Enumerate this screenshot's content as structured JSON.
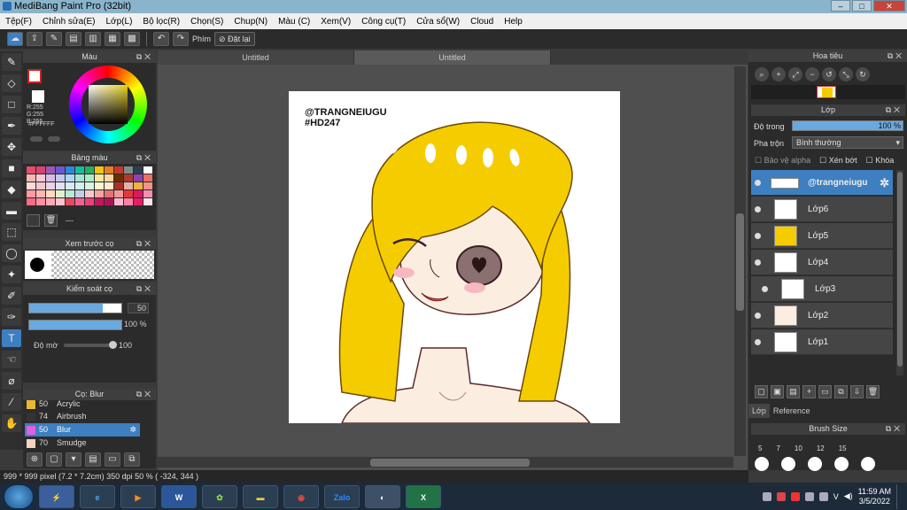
{
  "app": {
    "title": "MediBang Paint Pro (32bit)"
  },
  "window_buttons": [
    "–",
    "□",
    "✕"
  ],
  "menu": [
    "Tệp(F)",
    "Chỉnh sửa(E)",
    "Lớp(L)",
    "Bộ lọc(R)",
    "Chọn(S)",
    "Chup(N)",
    "Màu (C)",
    "Xem(V)",
    "Công cụ(T)",
    "Cửa sổ(W)",
    "Cloud",
    "Help"
  ],
  "toolbar": {
    "shortcut_label": "Phím",
    "reset_label": "Đặt lại"
  },
  "color_panel": {
    "title": "Màu",
    "r": "R:255",
    "g": "G:255",
    "b": "B:255",
    "hex": "#FFFFFF"
  },
  "palette_panel": {
    "title": "Bảng màu",
    "dash": "---"
  },
  "preview_panel": {
    "title": "Xem trước cọ"
  },
  "control_panel": {
    "title": "Kiểm soát cọ",
    "size_value": "50",
    "size_fill": 0.8,
    "opacity_value": "100 %",
    "opacity_fill": 1.0,
    "density_label": "Độ mờ",
    "density_value": "100"
  },
  "brush_panel": {
    "title": "Cọ: Blur",
    "items": [
      {
        "size": "50",
        "name": "Acrylic",
        "color": "#e8b830"
      },
      {
        "size": "74",
        "name": "Airbrush",
        "color": "#333333"
      },
      {
        "size": "50",
        "name": "Blur",
        "color": "#e060e0",
        "selected": true
      },
      {
        "size": "70",
        "name": "Smudge",
        "color": "#f5d5c0"
      }
    ]
  },
  "document_tabs": [
    {
      "label": "Untitled",
      "active": false
    },
    {
      "label": "Untitled",
      "active": true
    }
  ],
  "canvas_text": {
    "line1": "@TRANGNEIUGU",
    "line2": "#HD247"
  },
  "status": "999 * 999 pixel   (7.2 * 7.2cm)   350 dpi   50 %   ( -324, 344 )",
  "navigator": {
    "title": "Hoa tiêu"
  },
  "layer_panel": {
    "title": "Lớp",
    "opacity_label": "Độ trong",
    "opacity_value": "100 %",
    "blend_label": "Pha trộn",
    "blend_value": "Bình thường",
    "protect_alpha": "Bảo vệ alpha",
    "clipping": "Xén bớt",
    "lock": "Khóa",
    "layers": [
      {
        "name": "@trangneiugu",
        "selected": true
      },
      {
        "name": "Lớp6"
      },
      {
        "name": "Lớp5"
      },
      {
        "name": "Lớp4"
      },
      {
        "name": "Lớp3",
        "indent": true
      },
      {
        "name": "Lớp2"
      },
      {
        "name": "Lớp1"
      }
    ],
    "tabs": [
      "Lớp",
      "Reference"
    ]
  },
  "brush_size": {
    "title": "Brush Size",
    "sizes": [
      "5",
      "7",
      "10",
      "12",
      "15"
    ]
  },
  "taskbar": {
    "apps": [
      "W",
      "Zalo",
      "X"
    ],
    "tray_lang": "V",
    "time": "11:59 AM",
    "date": "3/5/2022"
  },
  "accent": "#3d7fc0",
  "hair_color": "#f5cc00"
}
